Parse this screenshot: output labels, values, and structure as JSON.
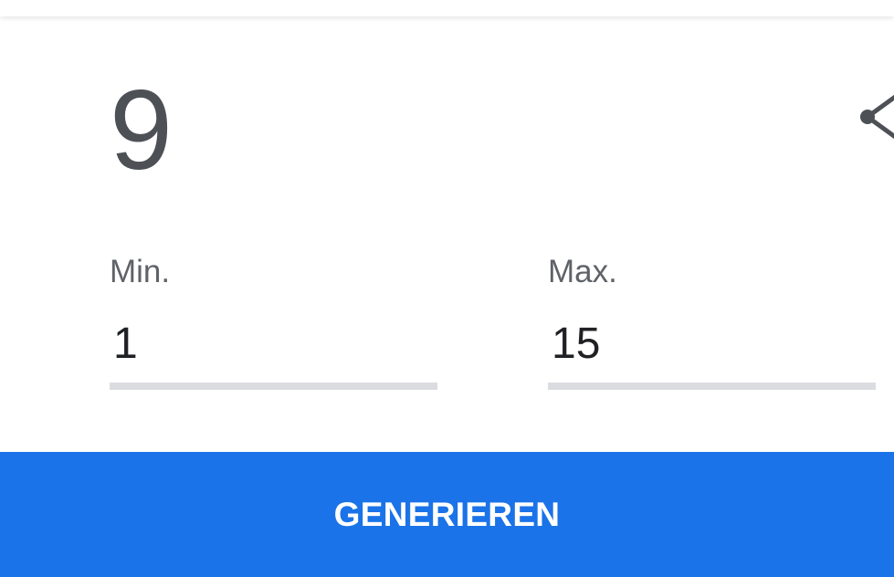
{
  "result": {
    "value": "9"
  },
  "fields": {
    "min": {
      "label": "Min.",
      "value": "1"
    },
    "max": {
      "label": "Max.",
      "value": "15"
    }
  },
  "actions": {
    "generate_label": "GENERIEREN",
    "share_icon": "share-icon"
  },
  "colors": {
    "accent": "#1a73e8",
    "result_text": "#4d5156",
    "label_text": "#5f6368",
    "input_text": "#202124",
    "underline": "#dadce0"
  }
}
